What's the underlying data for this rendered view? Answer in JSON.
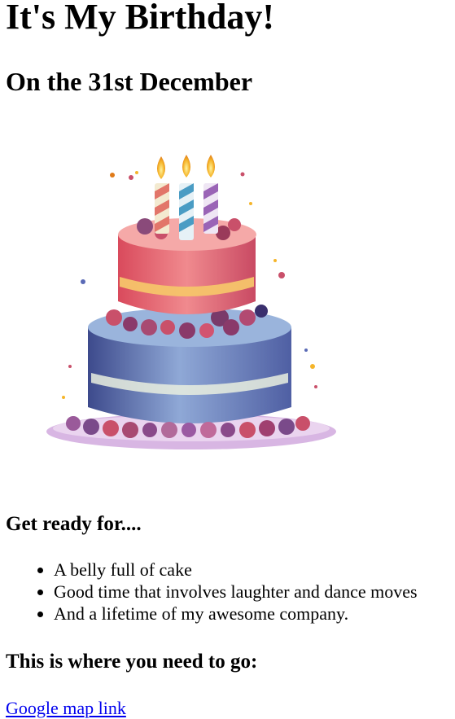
{
  "page": {
    "title": "It's My Birthday!",
    "subtitle": "On the 31st December"
  },
  "image": {
    "alt": "Watercolor birthday cake with three lit candles"
  },
  "ready": {
    "heading": "Get ready for....",
    "items": [
      "A belly full of cake",
      "Good time that involves laughter and dance moves",
      "And a lifetime of my awesome company."
    ]
  },
  "location": {
    "heading": "This is where you need to go:",
    "link_text": "Google map link"
  },
  "colors": {
    "link": "#0000ee",
    "text": "#000000",
    "background": "#ffffff"
  }
}
